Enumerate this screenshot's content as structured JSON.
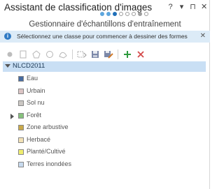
{
  "header": {
    "title": "Assistant de classification d'images",
    "controls": {
      "help": "?",
      "menu": "▾",
      "pin": "⊓",
      "close": "✕"
    }
  },
  "steps": [
    "filled",
    "filled",
    "active",
    "empty",
    "empty",
    "empty",
    "gray",
    "empty"
  ],
  "subtitle": "Gestionnaire d'échantillons d'entraînement",
  "info": {
    "icon": "i",
    "text": "Sélectionnez une classe pour commencer à dessiner des formes",
    "close": "✕"
  },
  "toolbar": {
    "icons": [
      "point-tool-icon",
      "rectangle-tool-icon",
      "polygon-tool-icon",
      "circle-tool-icon",
      "freehand-tool-icon",
      "select-tool-icon",
      "save-icon",
      "save-as-icon",
      "add-class-icon",
      "remove-class-icon"
    ]
  },
  "tree": {
    "root_label": "NLCD2011",
    "items": [
      {
        "label": "Eau",
        "color": "#476ba0",
        "expandable": false
      },
      {
        "label": "Urbain",
        "color": "#dcc5c5",
        "expandable": false
      },
      {
        "label": "Sol nu",
        "color": "#ccc8c4",
        "expandable": false
      },
      {
        "label": "Forêt",
        "color": "#86c27c",
        "expandable": true
      },
      {
        "label": "Zone arbustive",
        "color": "#c9a94a",
        "expandable": false
      },
      {
        "label": "Herbacé",
        "color": "#f3e2b6",
        "expandable": false
      },
      {
        "label": "Planté/Cultivé",
        "color": "#f0ee6e",
        "expandable": false
      },
      {
        "label": "Terres inondées",
        "color": "#c8dbef",
        "expandable": false
      }
    ]
  }
}
